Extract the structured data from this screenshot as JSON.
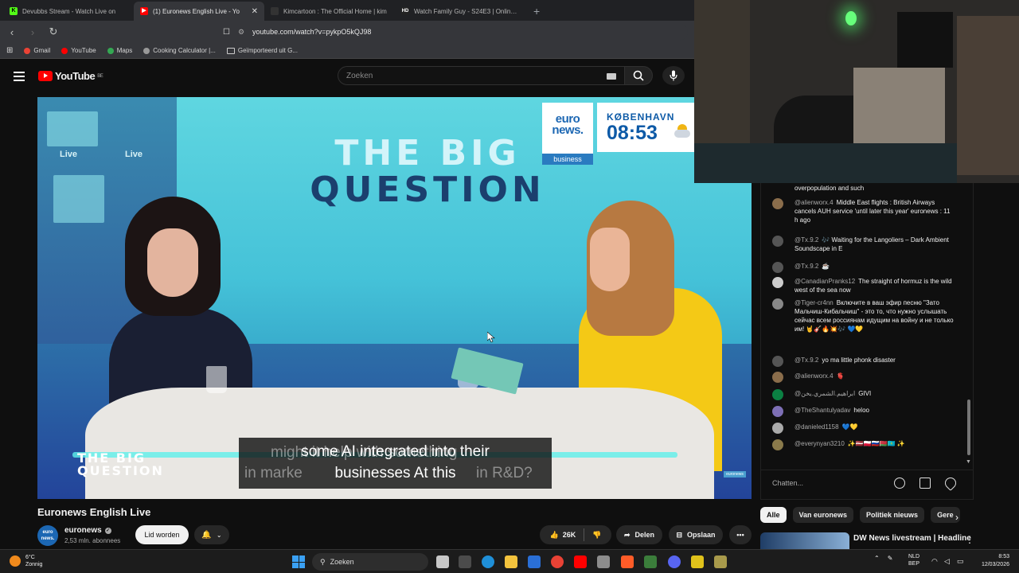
{
  "browser": {
    "tabs": [
      {
        "title": "Devubbs Stream - Watch Live on",
        "icon": "kick-icon",
        "color": "#53fc18",
        "active": false
      },
      {
        "title": "(1) Euronews English Live - Yo",
        "icon": "youtube-icon",
        "color": "#ff0000",
        "active": true
      },
      {
        "title": "Kimcartoon : The Official Home | kim",
        "icon": "kimcartoon-icon",
        "color": "#333333",
        "active": false
      },
      {
        "title": "Watch Family Guy - S24E3 | Online H",
        "icon": "hd-icon",
        "color": "#222222",
        "active": false
      }
    ],
    "url": "youtube.com/watch?v=pykpO5kQJ98",
    "bookmarks": [
      {
        "label": "Gmail",
        "color": "#ea4335"
      },
      {
        "label": "YouTube",
        "color": "#ff0000"
      },
      {
        "label": "Maps",
        "color": "#34a853"
      },
      {
        "label": "Cooking Calculator |...",
        "color": "#999999"
      },
      {
        "label": "Geïmporteerd uit G...",
        "color": "#cccccc"
      }
    ]
  },
  "youtube": {
    "logo_text": "YouTube",
    "region": "BE",
    "search_placeholder": "Zoeken",
    "video": {
      "show_title_l1": "THE BIG",
      "show_title_l2": "QUESTION",
      "live_label": "Live",
      "brand_l1": "euro",
      "brand_l2": "news.",
      "brand_section": "business",
      "city": "KØBENHAVN",
      "clock": "08:53",
      "corner_logo_l1": "THE BIG",
      "corner_logo_l2": "QUESTION",
      "subtitle_line1": "some AI integrated into their",
      "subtitle_line2": "businesses At this",
      "subtitle_ghost_top": "might it help with something",
      "subtitle_ghost_left": "in marke",
      "subtitle_ghost_right": "in R&D?",
      "watermark": "euronews"
    },
    "title": "Euronews English Live",
    "channel": {
      "name": "euronews",
      "avatar_l1": "euro",
      "avatar_l2": "news.",
      "subscribers": "2,53 mln. abonnees",
      "join_label": "Lid worden"
    },
    "actions": {
      "likes": "26K",
      "share_label": "Delen",
      "save_label": "Opslaan"
    }
  },
  "chat": {
    "messages": [
      {
        "author": "",
        "text": "overpopulation and such"
      },
      {
        "author": "@alienworx.4",
        "text": "Middle East flights : British Airways cancels AUH service 'until later this year' euronews : 11 h ago"
      },
      {
        "author": "@Tx.9.2",
        "text": "🎶 Waiting for the Langoliers – Dark Ambient Soundscape in E"
      },
      {
        "author": "@Tx.9.2",
        "text": "☕"
      },
      {
        "author": "@CanadianPranks12",
        "text": "The straight of hormuz is the wild west of the sea now"
      },
      {
        "author": "@Tiger-cr4nn",
        "text": "Включите в ваш эфир песню \"Зато Мальчиш-Кибальчиш\" - это то, что нужно услышать сейчас всем россиянам идущим на войну и не только им! 🤘🎸🔥💥🎶 💙💛"
      },
      {
        "author": "@Tx.9.2",
        "text": "yo ma little phonk disaster"
      },
      {
        "author": "@alienworx.4",
        "text": "🫀"
      },
      {
        "author": "@ابراهيم.الشمري.يخن",
        "text": "GIVI"
      },
      {
        "author": "@TheShantulyadav",
        "text": "heloo"
      },
      {
        "author": "@danieled1158",
        "text": "💙💛"
      },
      {
        "author": "@everynyan3210",
        "text": "✨🇱🇻🇵🇱🇷🇺🇧🇾🇰🇿 ✨"
      }
    ],
    "input_placeholder": "Chatten...",
    "chips": [
      "Alle",
      "Van euronews",
      "Politiek nieuws",
      "Gere"
    ],
    "recommendation_title": "DW News livestream | Headline"
  },
  "taskbar": {
    "temp": "6°C",
    "weather": "Zonnig",
    "search_label": "Zoeken",
    "lang1": "NLD",
    "lang2": "BEP",
    "time": "8:53",
    "date": "12/03/2026"
  }
}
